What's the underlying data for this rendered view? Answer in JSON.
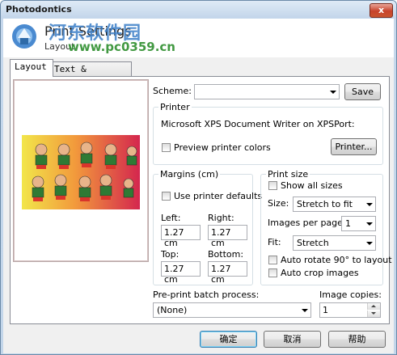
{
  "window": {
    "title": "Photodontics",
    "close_label": "x"
  },
  "header": {
    "title": "Print Settings",
    "subtitle": "Layout",
    "watermark_text": "河东软件园",
    "watermark_url": "www.pc0359.cn"
  },
  "tabs": [
    {
      "label": "Layout",
      "active": true
    },
    {
      "label": "Text & Options",
      "active": false
    }
  ],
  "scheme": {
    "label": "Scheme:",
    "value": "",
    "save_label": "Save"
  },
  "printer": {
    "group_label": "Printer",
    "name": "Microsoft XPS Document Writer on XPSPort:",
    "preview_colors_label": "Preview printer colors",
    "preview_colors_checked": false,
    "printer_button_label": "Printer..."
  },
  "margins": {
    "group_label": "Margins (cm)",
    "use_printer_defaults_label": "Use printer defaults",
    "use_printer_defaults_checked": false,
    "left_label": "Left:",
    "left_value": "1.27 cm",
    "right_label": "Right:",
    "right_value": "1.27 cm",
    "top_label": "Top:",
    "top_value": "1.27 cm",
    "bottom_label": "Bottom:",
    "bottom_value": "1.27 cm"
  },
  "print_size": {
    "group_label": "Print size",
    "show_all_sizes_label": "Show all sizes",
    "show_all_sizes_checked": false,
    "size_label": "Size:",
    "size_value": "Stretch to fit",
    "images_per_page_label": "Images per page:",
    "images_per_page_value": "1",
    "fit_label": "Fit:",
    "fit_value": "Stretch",
    "auto_rotate_label": "Auto rotate 90° to layout",
    "auto_rotate_checked": false,
    "auto_crop_label": "Auto crop images",
    "auto_crop_checked": false
  },
  "pre_print": {
    "label": "Pre-print batch process:",
    "value": "(None)"
  },
  "copies": {
    "label": "Image copies:",
    "value": "1"
  },
  "footer": {
    "ok_label": "确定",
    "cancel_label": "取消",
    "help_label": "帮助"
  },
  "colors": {
    "title_bar": "#c6d8ec",
    "close_button": "#c7432c",
    "default_button_border": "#3c7fb1"
  }
}
